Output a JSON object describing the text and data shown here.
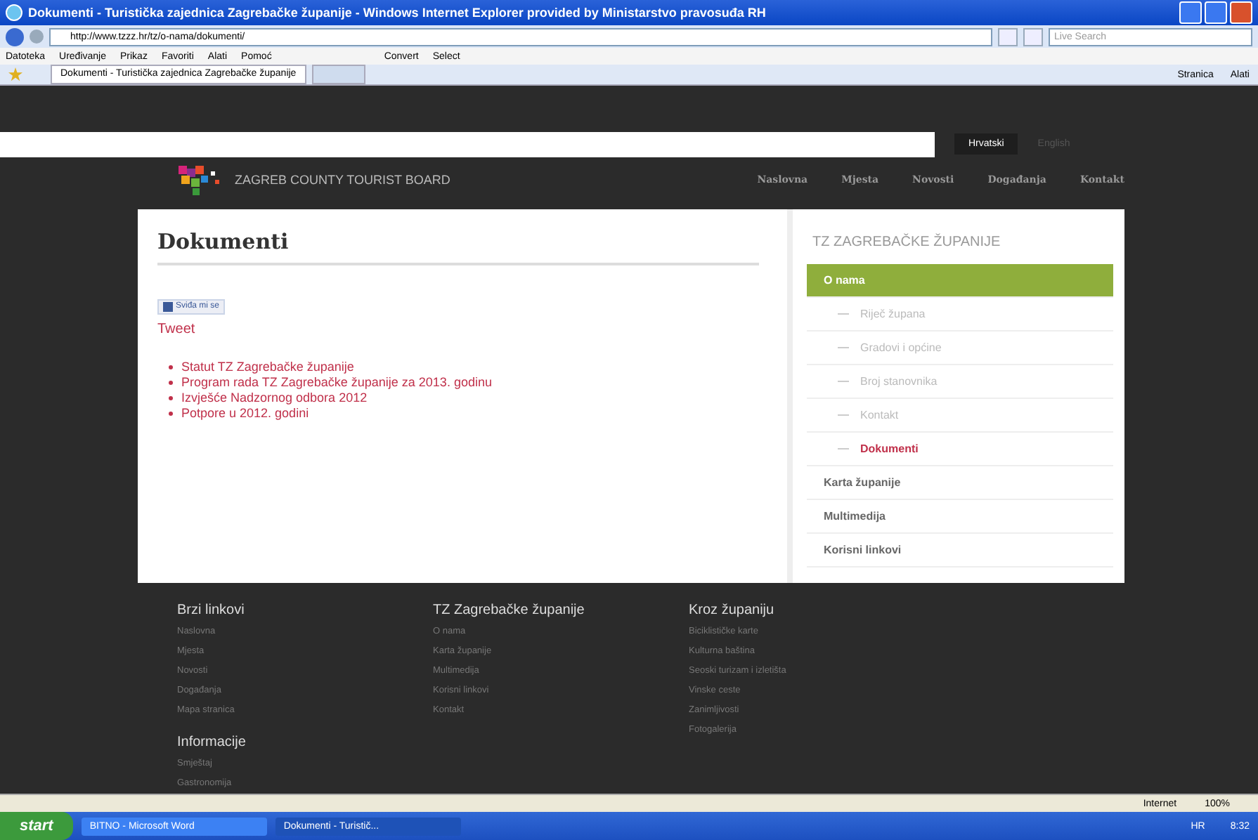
{
  "window": {
    "title": "Dokumenti - Turistička zajednica Zagrebačke županije - Windows Internet Explorer provided by Ministarstvo pravosuđa RH"
  },
  "address_bar": {
    "url": "http://www.tzzz.hr/tz/o-nama/dokumenti/",
    "search_placeholder": "Live Search"
  },
  "menu_bar": {
    "items": [
      "Datoteka",
      "Uređivanje",
      "Prikaz",
      "Favoriti",
      "Alati",
      "Pomoć"
    ],
    "convert": "Convert",
    "select": "Select"
  },
  "tab_bar": {
    "tabs": [
      {
        "label": "Dokumenti - Turistička zajednica Zagrebačke županije",
        "selected": true
      }
    ],
    "tools": [
      "Stranica",
      "Alati"
    ]
  },
  "site": {
    "languages": [
      {
        "label": "Hrvatski",
        "selected": true
      },
      {
        "label": "English",
        "selected": false
      }
    ],
    "brand": "ZAGREB COUNTY TOURIST BOARD",
    "nav": [
      "Naslovna",
      "Mjesta",
      "Novosti",
      "Događanja",
      "Kontakt"
    ],
    "page_title": "Dokumenti",
    "like_button": "Sviđa mi se",
    "tweet": "Tweet",
    "documents": [
      "Statut TZ Zagrebačke županije",
      "Program rada TZ Zagrebačke županije za 2013. godinu",
      "Izvješće Nadzornog odbora 2012",
      "Potpore u 2012. godini"
    ],
    "sidebar": {
      "title": "TZ ZAGREBAČKE ŽUPANIJE",
      "items": [
        {
          "label": "O nama",
          "kind": "top",
          "selected": true
        },
        {
          "label": "Riječ župana",
          "kind": "sub",
          "selected": false
        },
        {
          "label": "Gradovi i općine",
          "kind": "sub",
          "selected": false
        },
        {
          "label": "Broj stanovnika",
          "kind": "sub",
          "selected": false
        },
        {
          "label": "Kontakt",
          "kind": "sub",
          "selected": false
        },
        {
          "label": "Dokumenti",
          "kind": "sub",
          "selected": true
        },
        {
          "label": "Karta županije",
          "kind": "top",
          "selected": false
        },
        {
          "label": "Multimedija",
          "kind": "top",
          "selected": false
        },
        {
          "label": "Korisni linkovi",
          "kind": "top",
          "selected": false
        }
      ]
    },
    "footer": [
      {
        "heading": "Brzi linkovi",
        "links": [
          "Naslovna",
          "Mjesta",
          "Novosti",
          "Događanja",
          "Mapa stranica"
        ]
      },
      {
        "heading": "TZ Zagrebačke županije",
        "links": [
          "O nama",
          "Karta županije",
          "Multimedija",
          "Korisni linkovi",
          "Kontakt"
        ]
      },
      {
        "heading": "Kroz županiju",
        "links": [
          "Biciklističke karte",
          "Kulturna baština",
          "Seoski turizam i izletišta",
          "Vinske ceste",
          "Zanimljivosti",
          "Fotogalerija"
        ]
      }
    ],
    "footer_extra": {
      "heading": "Informacije",
      "links": [
        "Smještaj",
        "Gastronomija"
      ]
    }
  },
  "status_bar": {
    "zone": "Internet",
    "zoom": "100%"
  },
  "taskbar": {
    "start": "start",
    "tasks": [
      {
        "label": "BITNO - Microsoft Word",
        "selected": false
      },
      {
        "label": "Dokumenti - Turistič...",
        "selected": true
      }
    ],
    "lang": "HR",
    "clock": "8:32"
  }
}
